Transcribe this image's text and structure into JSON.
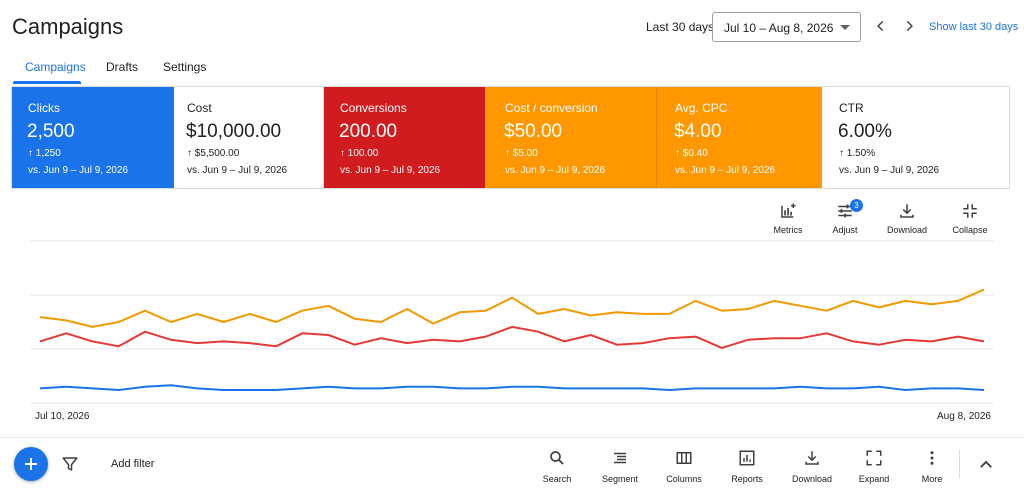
{
  "header": {
    "title": "Campaigns",
    "date_range_label": "Last 30 days",
    "date_range_value": "Jul 10 – Aug 8, 2026",
    "show_last_link": "Show last 30 days",
    "icons": [
      "chevron-left-icon",
      "chevron-right-icon",
      "dropdown-caret-icon"
    ]
  },
  "tabs": [
    {
      "label": "Campaigns",
      "active": true
    },
    {
      "label": "Drafts",
      "active": false
    },
    {
      "label": "Settings",
      "active": false
    }
  ],
  "metrics": [
    {
      "name": "Clicks",
      "value": "2,500",
      "delta": "↑ 1,250",
      "comparison": "vs. Jun 9 – Jul 9, 2026",
      "color": "#1a73e8",
      "selected": true
    },
    {
      "name": "Cost",
      "value": "$10,000.00",
      "delta": "↑ $5,500.00",
      "comparison": "vs. Jun 9 – Jul 9, 2026",
      "color": "#ffffff",
      "selected": false
    },
    {
      "name": "Conversions",
      "value": "200.00",
      "delta": "↑ 100.00",
      "comparison": "vs. Jun 9 – Jul 9, 2026",
      "color": "#d01c1f",
      "selected": true
    },
    {
      "name": "Cost / conversion",
      "value": "$50.00",
      "delta": "↑ $5.00",
      "comparison": "vs. Jun 9 – Jul 9, 2026",
      "color": "#ff9800",
      "selected": true
    },
    {
      "name": "Avg. CPC",
      "value": "$4.00",
      "delta": "↑ $0.40",
      "comparison": "vs. Jun 9 – Jul 9, 2026",
      "color": "#ff9800",
      "selected": true
    },
    {
      "name": "CTR",
      "value": "6.00%",
      "delta": "↑ 1.50%",
      "comparison": "vs. Jun 9 – Jul 9, 2026",
      "color": "#ffffff",
      "selected": false
    }
  ],
  "chart_tools": {
    "metrics": {
      "label": "Metrics",
      "icon": "add-chart-icon"
    },
    "adjust": {
      "label": "Adjust",
      "icon": "tune-icon",
      "badge": "3"
    },
    "download": {
      "label": "Download",
      "icon": "download-icon"
    },
    "collapse": {
      "label": "Collapse",
      "icon": "collapse-icon"
    }
  },
  "chart_data": {
    "type": "line",
    "x_start_label": "Jul 10, 2026",
    "x_end_label": "Aug 8, 2026",
    "grid": true,
    "ylim": [
      0,
      100
    ],
    "series": [
      {
        "color": "#f29900",
        "values": [
          53,
          51,
          47,
          50,
          57,
          50,
          55,
          50,
          55,
          50,
          57,
          60,
          52,
          50,
          58,
          49,
          56,
          57,
          65,
          55,
          58,
          54,
          56,
          55,
          55,
          63,
          57,
          58,
          63,
          60,
          57,
          63,
          59,
          63,
          61,
          63,
          70
        ]
      },
      {
        "color": "#e53935",
        "values": [
          38,
          43,
          38,
          35,
          44,
          39,
          37,
          38,
          37,
          35,
          43,
          42,
          36,
          40,
          37,
          39,
          38,
          41,
          47,
          44,
          38,
          42,
          36,
          37,
          40,
          41,
          34,
          39,
          40,
          40,
          43,
          38,
          36,
          39,
          38,
          41,
          38
        ]
      },
      {
        "color": "#1a73e8",
        "values": [
          9,
          10,
          9,
          8,
          10,
          11,
          9,
          8,
          8,
          8,
          9,
          10,
          9,
          9,
          10,
          10,
          9,
          9,
          10,
          10,
          9,
          9,
          9,
          9,
          8,
          9,
          9,
          9,
          9,
          10,
          9,
          9,
          10,
          8,
          9,
          9,
          8
        ]
      }
    ]
  },
  "bottom_toolbar": {
    "add_filter": "Add filter",
    "tools": [
      {
        "label": "Search",
        "icon": "search-icon"
      },
      {
        "label": "Segment",
        "icon": "segment-icon"
      },
      {
        "label": "Columns",
        "icon": "columns-icon"
      },
      {
        "label": "Reports",
        "icon": "reports-icon"
      },
      {
        "label": "Download",
        "icon": "download-icon"
      },
      {
        "label": "Expand",
        "icon": "expand-icon"
      },
      {
        "label": "More",
        "icon": "more-vert-icon"
      }
    ]
  }
}
